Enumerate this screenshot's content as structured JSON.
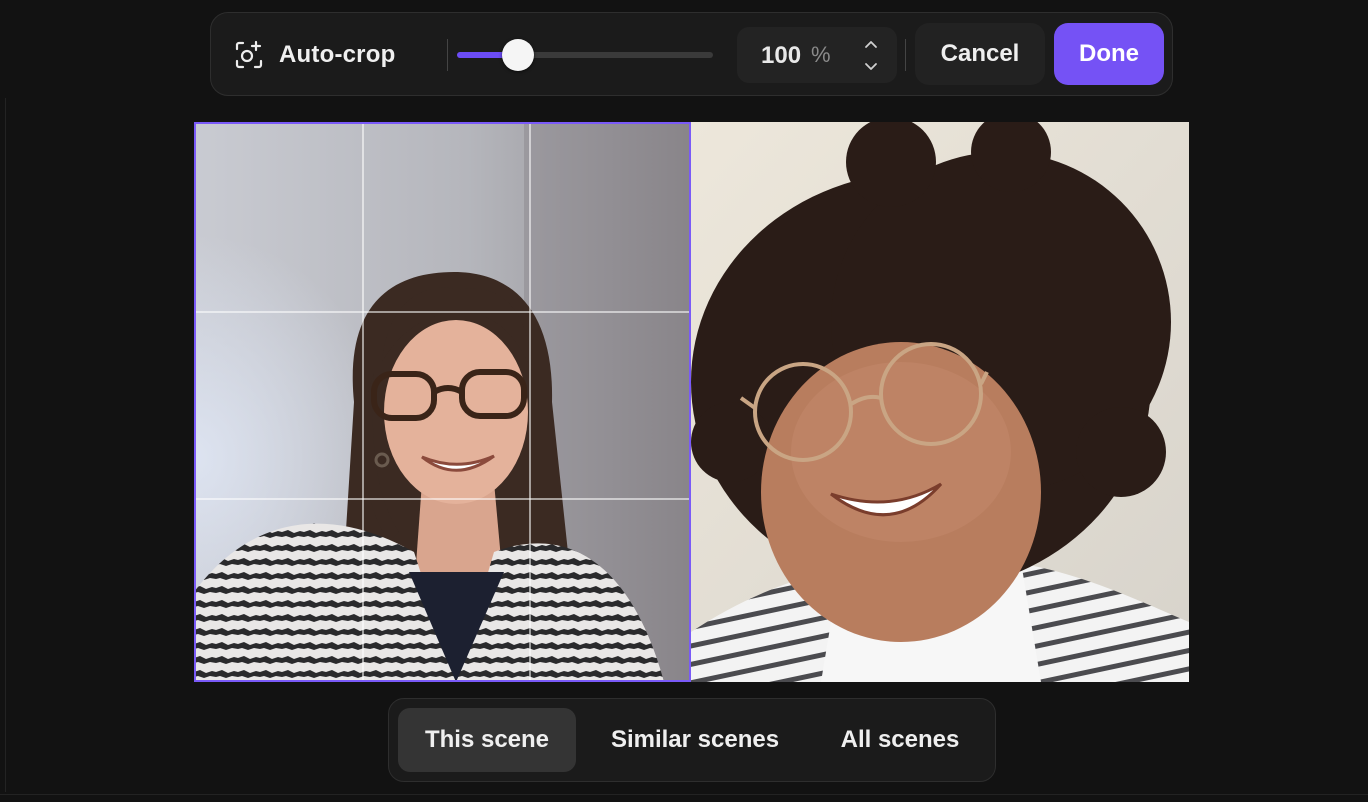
{
  "toolbar": {
    "autocrop_icon": "camera-focus-sparkle-icon",
    "autocrop_label": "Auto-crop",
    "zoom_slider_level": 0.24,
    "zoom_value": "100",
    "zoom_unit": "%",
    "zoom_up_icon": "chevron-up-icon",
    "zoom_down_icon": "chevron-down-icon",
    "cancel_label": "Cancel",
    "done_label": "Done"
  },
  "colors": {
    "accent": "#7552f5",
    "crop_border": "#7a5af8",
    "background": "#121212",
    "panel": "#1b1b1b"
  },
  "scope": {
    "options": [
      {
        "label": "This scene",
        "active": true
      },
      {
        "label": "Similar scenes",
        "active": false
      },
      {
        "label": "All scenes",
        "active": false
      }
    ]
  }
}
